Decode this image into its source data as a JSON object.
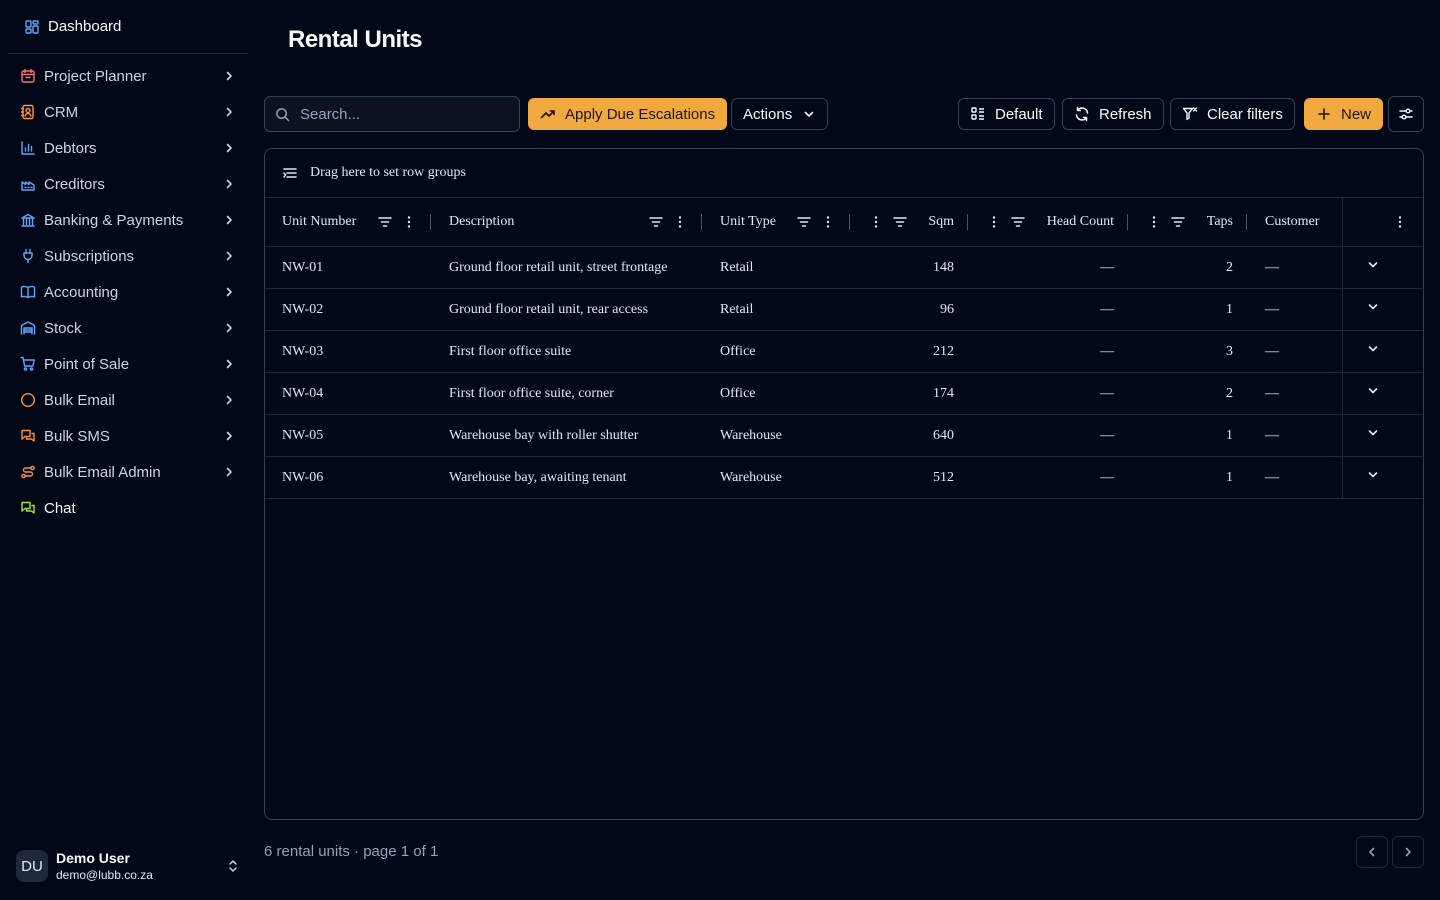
{
  "sidebar": {
    "dashboard": "Dashboard",
    "items": [
      {
        "label": "Project Planner",
        "icon": "calendar-icon",
        "color": "#f87171"
      },
      {
        "label": "CRM",
        "icon": "contact-icon",
        "color": "#fb923c"
      },
      {
        "label": "Debtors",
        "icon": "bar-chart-icon",
        "color": "#60a5fa"
      },
      {
        "label": "Creditors",
        "icon": "factory-icon",
        "color": "#60a5fa"
      },
      {
        "label": "Banking & Payments",
        "icon": "bank-icon",
        "color": "#60a5fa"
      },
      {
        "label": "Subscriptions",
        "icon": "plug-icon",
        "color": "#60a5fa"
      },
      {
        "label": "Accounting",
        "icon": "book-icon",
        "color": "#60a5fa"
      },
      {
        "label": "Stock",
        "icon": "warehouse-icon",
        "color": "#60a5fa"
      },
      {
        "label": "Point of Sale",
        "icon": "cart-icon",
        "color": "#60a5fa"
      },
      {
        "label": "Bulk Email",
        "icon": "circle-icon",
        "color": "#fb923c"
      },
      {
        "label": "Bulk SMS",
        "icon": "messages-icon",
        "color": "#fb923c"
      },
      {
        "label": "Bulk Email Admin",
        "icon": "route-icon",
        "color": "#fb923c"
      },
      {
        "label": "Chat",
        "icon": "chat-icon",
        "color": "#a3e635"
      }
    ],
    "user": {
      "initials": "DU",
      "name": "Demo User",
      "email": "demo@lubb.co.za"
    }
  },
  "page": {
    "title": "Rental Units"
  },
  "toolbar": {
    "search_placeholder": "Search...",
    "apply_label": "Apply Due Escalations",
    "actions_label": "Actions",
    "default_label": "Default",
    "refresh_label": "Refresh",
    "clear_label": "Clear filters",
    "new_label": "New"
  },
  "grid": {
    "group_panel": "Drag here to set row groups",
    "columns": [
      "Unit Number",
      "Description",
      "Unit Type",
      "Sqm",
      "Head Count",
      "Taps",
      "Customer"
    ],
    "rows": [
      {
        "unit": "NW-01",
        "description": "Ground floor retail unit, street frontage",
        "type": "Retail",
        "sqm": "148",
        "headcount": "—",
        "taps": "2",
        "customer": "—"
      },
      {
        "unit": "NW-02",
        "description": "Ground floor retail unit, rear access",
        "type": "Retail",
        "sqm": "96",
        "headcount": "—",
        "taps": "1",
        "customer": "—"
      },
      {
        "unit": "NW-03",
        "description": "First floor office suite",
        "type": "Office",
        "sqm": "212",
        "headcount": "—",
        "taps": "3",
        "customer": "—"
      },
      {
        "unit": "NW-04",
        "description": "First floor office suite, corner",
        "type": "Office",
        "sqm": "174",
        "headcount": "—",
        "taps": "2",
        "customer": "—"
      },
      {
        "unit": "NW-05",
        "description": "Warehouse bay with roller shutter",
        "type": "Warehouse",
        "sqm": "640",
        "headcount": "—",
        "taps": "1",
        "customer": "—"
      },
      {
        "unit": "NW-06",
        "description": "Warehouse bay, awaiting tenant",
        "type": "Warehouse",
        "sqm": "512",
        "headcount": "—",
        "taps": "1",
        "customer": "—"
      }
    ]
  },
  "footer": {
    "summary": "6 rental units · page 1 of 1"
  },
  "colors": {
    "accent": "#f0a93f",
    "background": "#020817",
    "border": "#334155"
  }
}
